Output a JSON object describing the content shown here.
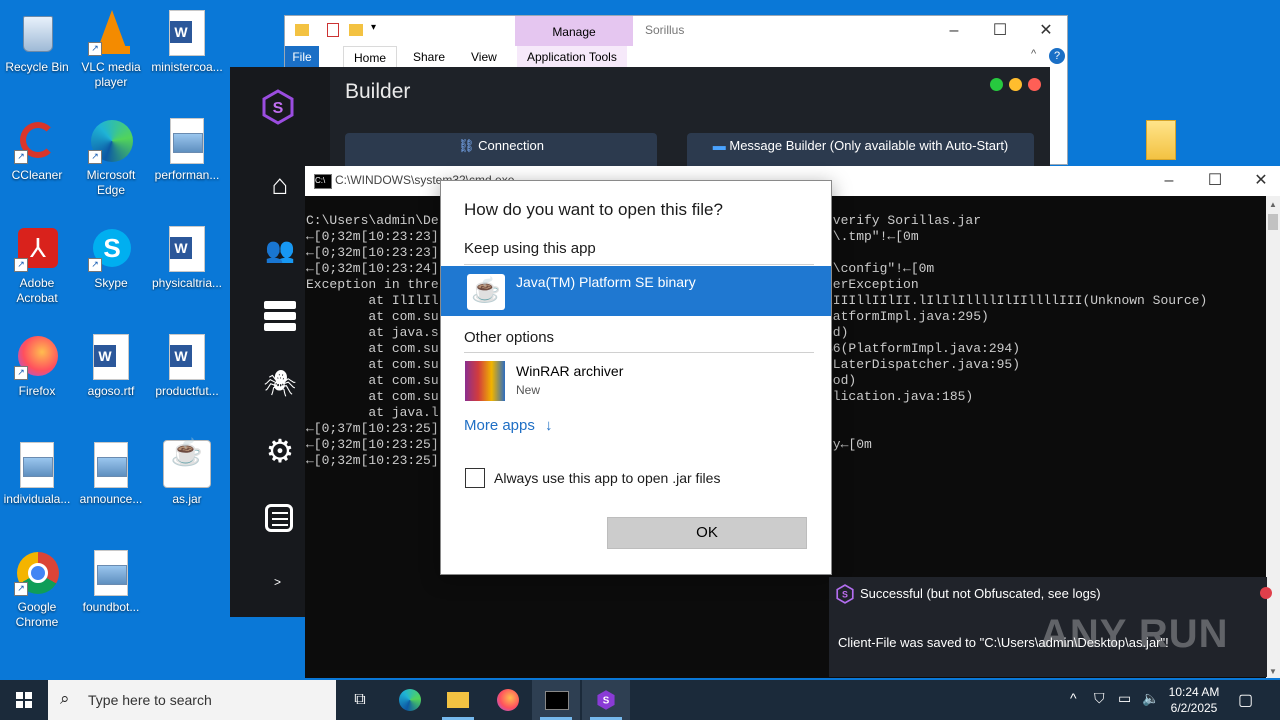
{
  "desktop": {
    "icons": [
      {
        "label": "Recycle Bin"
      },
      {
        "label": "VLC media player"
      },
      {
        "label": "ministercoa..."
      },
      {
        "label": "CCleaner"
      },
      {
        "label": "Microsoft Edge"
      },
      {
        "label": "performan..."
      },
      {
        "label": "Adobe Acrobat"
      },
      {
        "label": "Skype"
      },
      {
        "label": "physicaltria..."
      },
      {
        "label": "Firefox"
      },
      {
        "label": "agoso.rtf"
      },
      {
        "label": "productfut..."
      },
      {
        "label": "individuala..."
      },
      {
        "label": "announce..."
      },
      {
        "label": "as.jar"
      },
      {
        "label": "Google Chrome"
      },
      {
        "label": "foundbot..."
      }
    ]
  },
  "explorer": {
    "title": "Sorillus",
    "context_tab": "Manage",
    "tabs": [
      "File",
      "Home",
      "Share",
      "View",
      "Application Tools"
    ]
  },
  "builder": {
    "title": "Builder",
    "tab_connection": "Connection",
    "tab_message": "Message Builder (Only available with Auto-Start)",
    "expand_label": ">"
  },
  "cmd": {
    "title": "C:\\WINDOWS\\system32\\cmd.exe",
    "lines": [
      "C:\\Users\\admin\\De",
      "←[0;32m[10:23:23]",
      "←[0;32m[10:23:23]",
      "←[0;32m[10:23:24]",
      "Exception in thre",
      "        at IlIlIl",
      "        at com.su",
      "        at java.s",
      "        at com.su",
      "        at com.su",
      "        at com.su",
      "        at com.su",
      "        at java.l",
      "←[0;37m[10:23:25]",
      "←[0;32m[10:23:25]",
      "←[0;32m[10:23:25]"
    ],
    "right_lines": [
      "overify Sorillas.jar",
      "s\\.tmp\"!←[0m",
      "",
      "s\\config\"!←[0m",
      "terException",
      "lIIIllIIlII.lIlIlIllllIlIIllllIII(Unknown Source)",
      "latformImpl.java:295)",
      "od)",
      "$6(PlatformImpl.java:294)",
      "eLaterDispatcher.java:95)",
      "hod)",
      "plication.java:185)",
      "",
      "",
      "ty←[0m",
      ""
    ]
  },
  "dialog": {
    "heading": "How do you want to open this file?",
    "keep_using": "Keep using this app",
    "selected_app": "Java(TM) Platform SE binary",
    "other_options": "Other options",
    "other_app": "WinRAR archiver",
    "other_app_sub": "New",
    "more_apps": "More apps",
    "more_apps_arrow": "↓",
    "always_use": "Always use this app to open .jar files",
    "ok": "OK"
  },
  "toast": {
    "title": "Successful (but not Obfuscated, see logs)",
    "message": "Client-File was saved to \"C:\\Users\\admin\\Desktop\\as.jar\"!"
  },
  "watermark": "ANY RUN",
  "taskbar": {
    "search_placeholder": "Type here to search",
    "time": "10:24 AM",
    "date": "6/2/2025"
  },
  "colors": {
    "desktop": "#0a78d7",
    "selection": "#1f78d1",
    "accent_purple": "#8a3bd6",
    "toast_bg": "#20232a"
  }
}
